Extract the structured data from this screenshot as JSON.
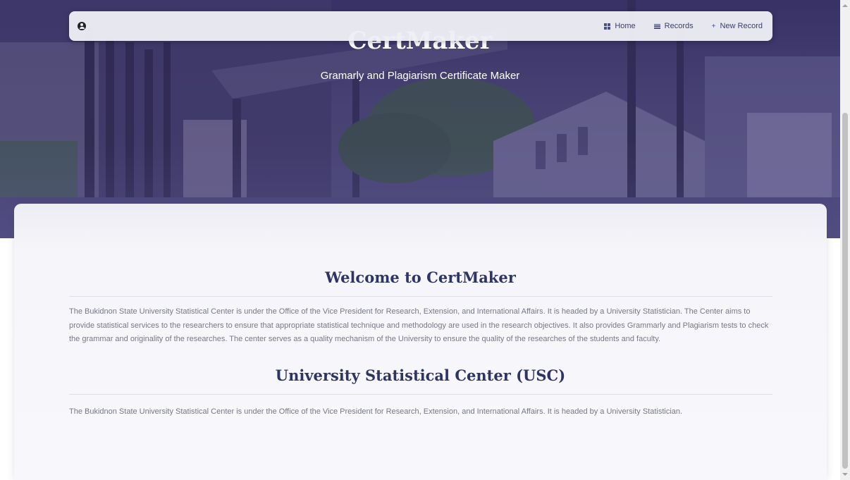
{
  "hero": {
    "title": "CertMaker",
    "subtitle": "Gramarly and Plagiarism Certificate Maker"
  },
  "navbar": {
    "brand_icon": "user-circle-icon",
    "items": [
      {
        "label": "Home",
        "icon": "grid-icon"
      },
      {
        "label": "Records",
        "icon": "list-icon"
      },
      {
        "label": "New Record",
        "icon": "plus-icon"
      }
    ]
  },
  "welcome": {
    "title": "Welcome to CertMaker",
    "text": "The Bukidnon State University Statistical Center is under the Office of the Vice President for Research, Extension, and International Affairs. It is headed by a University Statistician. The Center aims to provide statistical services to the researchers to ensure that appropriate statistical technique and methodology are used in the research objectives. It also provides Grammarly and Plagiarism tests to check the grammar and originality of the researches. The center serves as a quality mechanism of the University to ensure the quality of the researches of the students and faculty."
  },
  "usc": {
    "title": "University Statistical Center (USC)",
    "text": "The Bukidnon State University Statistical Center is under the Office of the Vice President for Research, Extension, and International Affairs. It is headed by a University Statistician."
  },
  "colors": {
    "accent": "#2e3564",
    "hero_tint": "#4a4570",
    "body_text": "#757786"
  }
}
